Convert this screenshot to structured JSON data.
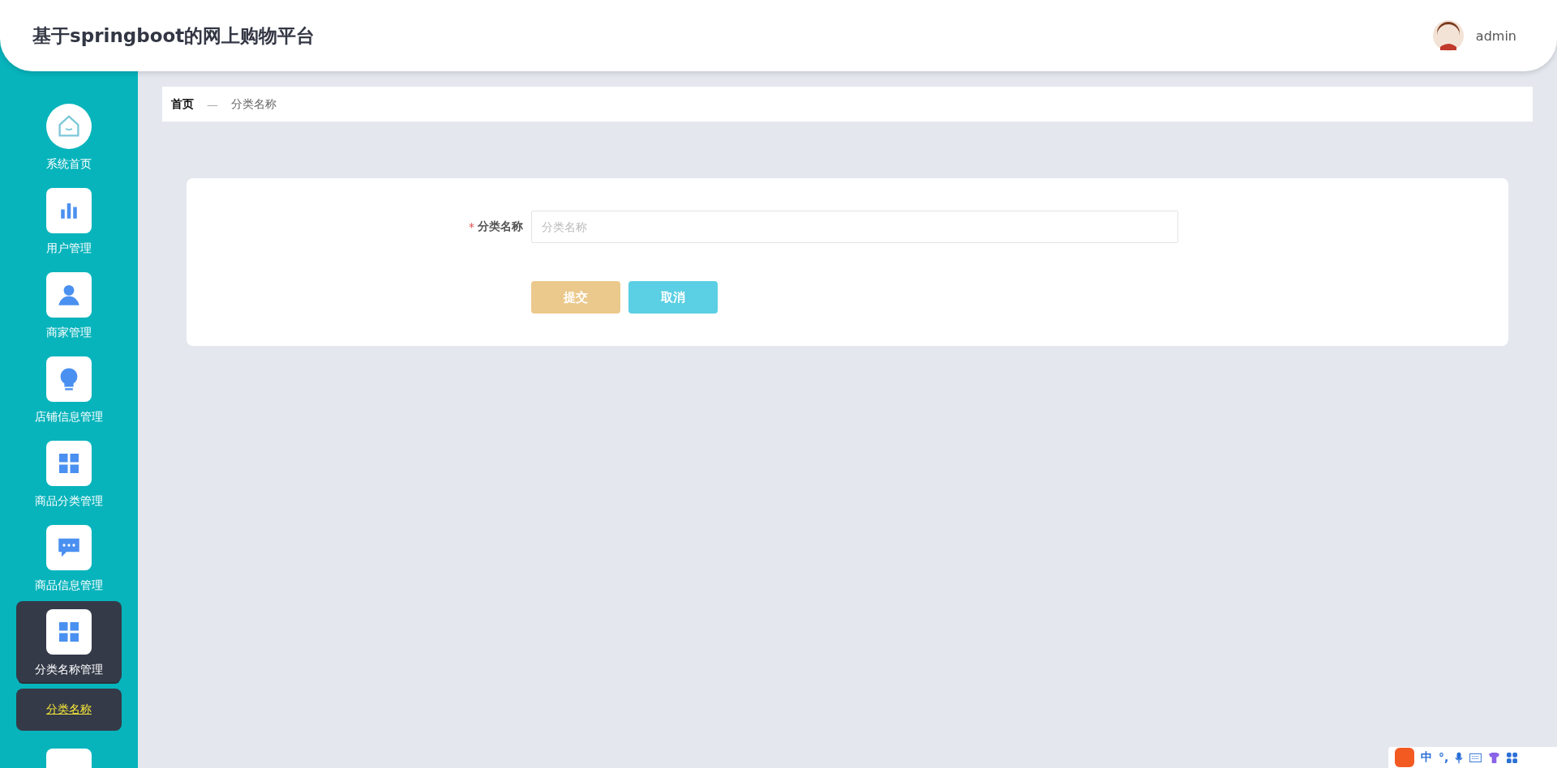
{
  "header": {
    "title": "基于springboot的网上购物平台",
    "user": "admin"
  },
  "sidebar": {
    "items": [
      {
        "label": "系统首页",
        "kind": "home",
        "selected": false
      },
      {
        "label": "用户管理",
        "kind": "chart",
        "selected": false
      },
      {
        "label": "商家管理",
        "kind": "user",
        "selected": false
      },
      {
        "label": "店铺信息管理",
        "kind": "bulb",
        "selected": false
      },
      {
        "label": "商品分类管理",
        "kind": "grid",
        "selected": false
      },
      {
        "label": "商品信息管理",
        "kind": "chat",
        "selected": false
      },
      {
        "label": "分类名称管理",
        "kind": "grid",
        "selected": true,
        "expanded": true,
        "children": [
          {
            "label": "分类名称",
            "selected": true
          }
        ]
      }
    ]
  },
  "breadcrumb": [
    "首页",
    "—",
    "分类名称"
  ],
  "form": {
    "fields": [
      {
        "label": "分类名称",
        "required_mark": "*",
        "placeholder": "分类名称"
      }
    ],
    "buttons": [
      {
        "label": "提交",
        "kind": "submit"
      },
      {
        "label": "取消",
        "kind": "cancel"
      }
    ]
  },
  "ime_bar": {
    "mode": "中",
    "punct": "°,"
  }
}
